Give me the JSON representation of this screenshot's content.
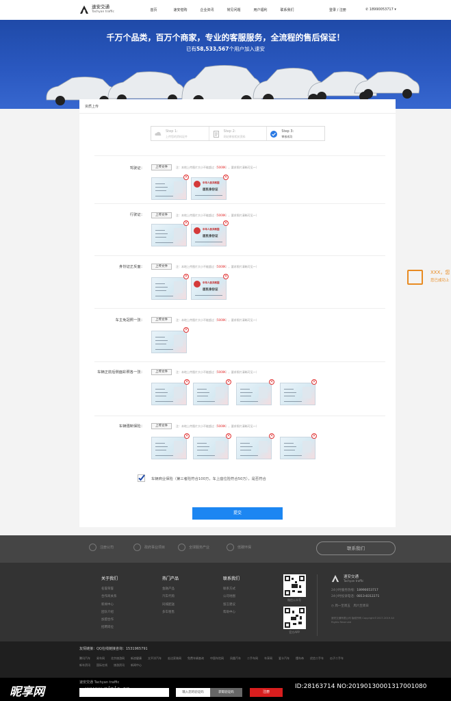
{
  "header": {
    "brand_cn": "速安交通",
    "brand_en": "Tachyan traffic",
    "nav": [
      "首页",
      "速安借购",
      "企业资讯",
      "常见问题",
      "用户福利",
      "联系我们"
    ],
    "login": "登录 / 注册",
    "phone": "18990053717"
  },
  "banner": {
    "title": "千万个品类，百万个商家，专业的客服服务，全流程的售后保证！",
    "sub_pre": "已有",
    "sub_num": "58,533,567",
    "sub_post": "个用户加入速安"
  },
  "crumb": "资质上传",
  "steps": [
    {
      "t1": "Step 1:",
      "t2": "上传您的资料证件"
    },
    {
      "t1": "Step 2:",
      "t2": "网站审核相关资料"
    },
    {
      "t1": "Step 3:",
      "t2": "审核成功"
    }
  ],
  "upload_label": "上传文件",
  "hint_pre": "注：本地上传图片大小不能超过（",
  "hint_red": "5000K",
  "hint_post": "），要求照片清晰可见～）",
  "card_back_title": "中华人民共和国",
  "card_back_title2": "居民身份证",
  "rows": [
    {
      "label": "驾驶证："
    },
    {
      "label": "行驶证："
    },
    {
      "label": "身份证正反面："
    },
    {
      "label": "车主免冠照一张："
    },
    {
      "label": "车辆正前后侧面彩照各一张："
    },
    {
      "label": "车辆强制保险："
    }
  ],
  "agree": "车辆商业保险（第三者险符合100万，车上座位险符合50万），是否符合",
  "submit": "提交",
  "float": {
    "t1": "XXX，您",
    "t2": "您已成功上"
  },
  "footer_band": {
    "items": [
      "注册公司",
      "政府事业项目",
      "全球服务产业",
      "低碳环保"
    ],
    "contact": "联系我们"
  },
  "footer_cols": [
    {
      "head": "关于我们",
      "items": [
        "名誉荣誉",
        "合作商关系",
        "新闻中心",
        "团队介绍",
        "加盟合作",
        "招聘岗位"
      ]
    },
    {
      "head": "热门产品",
      "items": [
        "金融产品",
        "汽车代购",
        "同城配送",
        "多车租售"
      ]
    },
    {
      "head": "联系我们",
      "items": [
        "联系方式",
        "公司地图",
        "留言建议",
        "帮助中心"
      ]
    }
  ],
  "qr_caps": [
    "微信公众号",
    "官方APP"
  ],
  "footer_right": {
    "brand_cn": "速安交通",
    "brand_en": "Tachyan traffic",
    "hotline_label": "24小时服务热线：",
    "hotline": "18990053717",
    "hotline2_label": "24小时投诉电话：",
    "hotline2": "0813-8312271",
    "hours1": "周一至周五",
    "hours2": "周六至周日",
    "copyright": "速安交通有限公司 版权所有 Copyright©2017-2019 All Rights Reserved"
  },
  "links": {
    "head": "友情链接：QQ在线链接咨询：1531965791",
    "row1": [
      "腾讯汽车",
      "易车网",
      "北京旅游网",
      "新浪健康",
      "太平洋汽车",
      "宏达家装网",
      "免费车辆查询",
      "中国车险网",
      "凤凰汽车",
      "二手车网",
      "车享网",
      "爱卡汽车",
      "懂车帝",
      "优信二手车",
      "瓜子二手车"
    ],
    "row2": [
      "新车资讯",
      "国际在线",
      "旅游资讯",
      "新闻中心"
    ]
  },
  "bottom": {
    "watermark": "昵享网",
    "url": "www.nipic.cn",
    "brand": "速安交通 Tachyan traffic",
    "input2": "输入您的验证码",
    "code_btn": "获取验证码",
    "register": "注册",
    "id": "ID:28163714 NO:20190130001317001080"
  },
  "colors": {
    "brand_blue": "#1f4aa8",
    "accent": "#1c86f2",
    "danger": "#e03030"
  }
}
